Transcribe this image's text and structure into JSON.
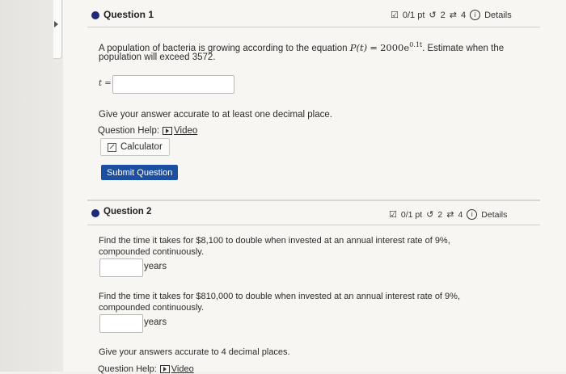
{
  "question1": {
    "title": "Question 1",
    "points": "0/1 pt",
    "retries": "2",
    "attempts": "4",
    "details_label": "Details",
    "prompt_before": "A population of bacteria is growing according to the equation",
    "equation_lhs": "P(t)",
    "equation_eq": "=",
    "equation_base": "2000e",
    "equation_exp": "0.1t",
    "prompt_after": ". Estimate when the",
    "prompt_line2": "population will exceed 3572.",
    "answer_var": "t =",
    "answer_value": "",
    "accuracy_note": "Give your answer accurate to at least one decimal place.",
    "help_label": "Question Help:",
    "video_label": "Video",
    "calculator_label": "Calculator",
    "submit_label": "Submit Question"
  },
  "question2": {
    "title": "Question 2",
    "points": "0/1 pt",
    "retries": "2",
    "attempts": "4",
    "details_label": "Details",
    "part1_line1": "Find the time it takes for $8,100 to double when invested at an annual interest rate of 9%,",
    "part1_line2": "compounded continuously.",
    "part1_units": "years",
    "part1_value": "",
    "part2_line1": "Find the time it takes for $810,000 to double when invested at an annual interest rate of 9%,",
    "part2_line2": "compounded continuously.",
    "part2_units": "years",
    "part2_value": "",
    "accuracy_note": "Give your answers accurate to 4 decimal places.",
    "help_label": "Question Help:",
    "video_label": "Video"
  },
  "colors": {
    "accent_dot": "#1e2a78",
    "submit_bg": "#1d4fa0"
  }
}
